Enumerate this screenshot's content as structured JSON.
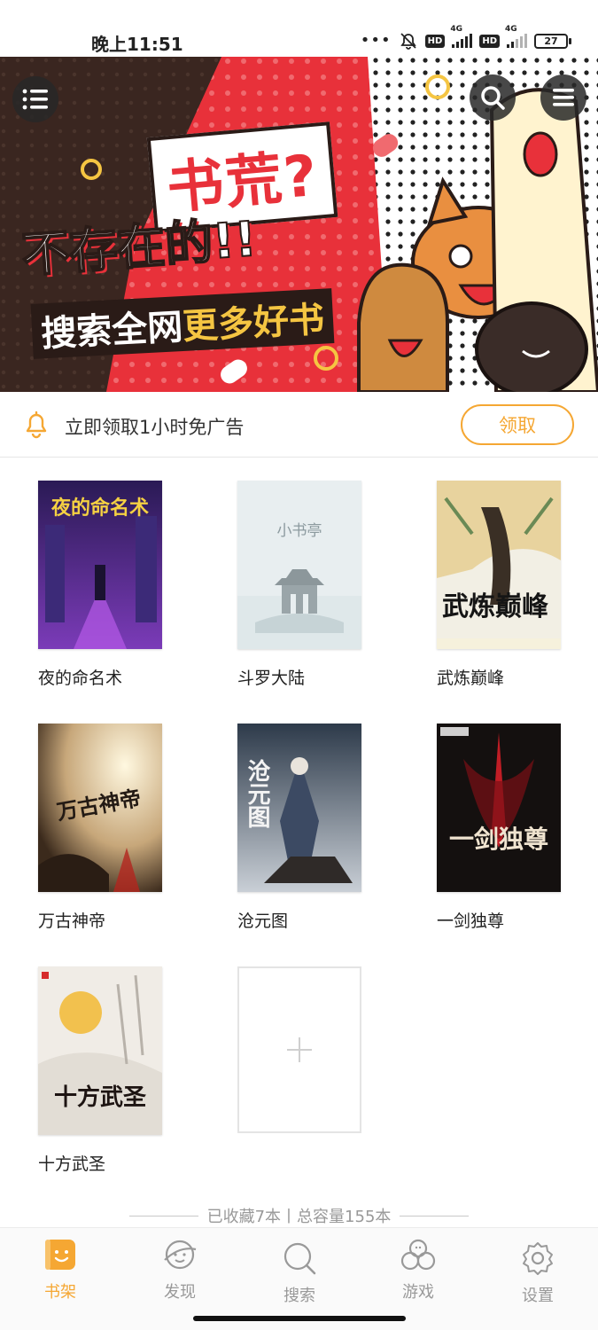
{
  "status_bar": {
    "time": "晚上11:51",
    "battery": "27",
    "network_1": "4G",
    "network_2": "4G",
    "hd_1": "HD",
    "hd_2": "HD"
  },
  "banner": {
    "title_main": "书荒?",
    "title_sub": "不存在的!!",
    "title_tag_a": "搜索全网",
    "title_tag_b": "更多好书",
    "left_button_icon": "menu-icon",
    "right_buttons": [
      "search-icon",
      "list-icon"
    ]
  },
  "reward": {
    "text": "立即领取1小时免广告",
    "button_label": "领取",
    "icon": "bell-icon"
  },
  "books": [
    {
      "title": "夜的命名术",
      "cover_text": "夜的命名术"
    },
    {
      "title": "斗罗大陆",
      "cover_text": "小书亭"
    },
    {
      "title": "武炼巅峰",
      "cover_text": "武炼巅峰"
    },
    {
      "title": "万古神帝",
      "cover_text": "万古神帝"
    },
    {
      "title": "沧元图",
      "cover_text": "沧元图"
    },
    {
      "title": "一剑独尊",
      "cover_text": "一剑独尊"
    },
    {
      "title": "十方武圣",
      "cover_text": "十方武圣"
    }
  ],
  "add_slot_icon": "plus-icon",
  "summary": {
    "text": "已收藏7本丨总容量155本"
  },
  "tabbar": {
    "items": [
      {
        "label": "书架",
        "icon": "bookshelf-icon",
        "active": true
      },
      {
        "label": "发现",
        "icon": "discover-icon",
        "active": false
      },
      {
        "label": "搜索",
        "icon": "search-icon",
        "active": false
      },
      {
        "label": "游戏",
        "icon": "game-icon",
        "active": false
      },
      {
        "label": "设置",
        "icon": "settings-icon",
        "active": false
      }
    ]
  },
  "colors": {
    "accent": "#f5a733",
    "banner_red": "#e8313a",
    "banner_dark": "#3a2620"
  }
}
